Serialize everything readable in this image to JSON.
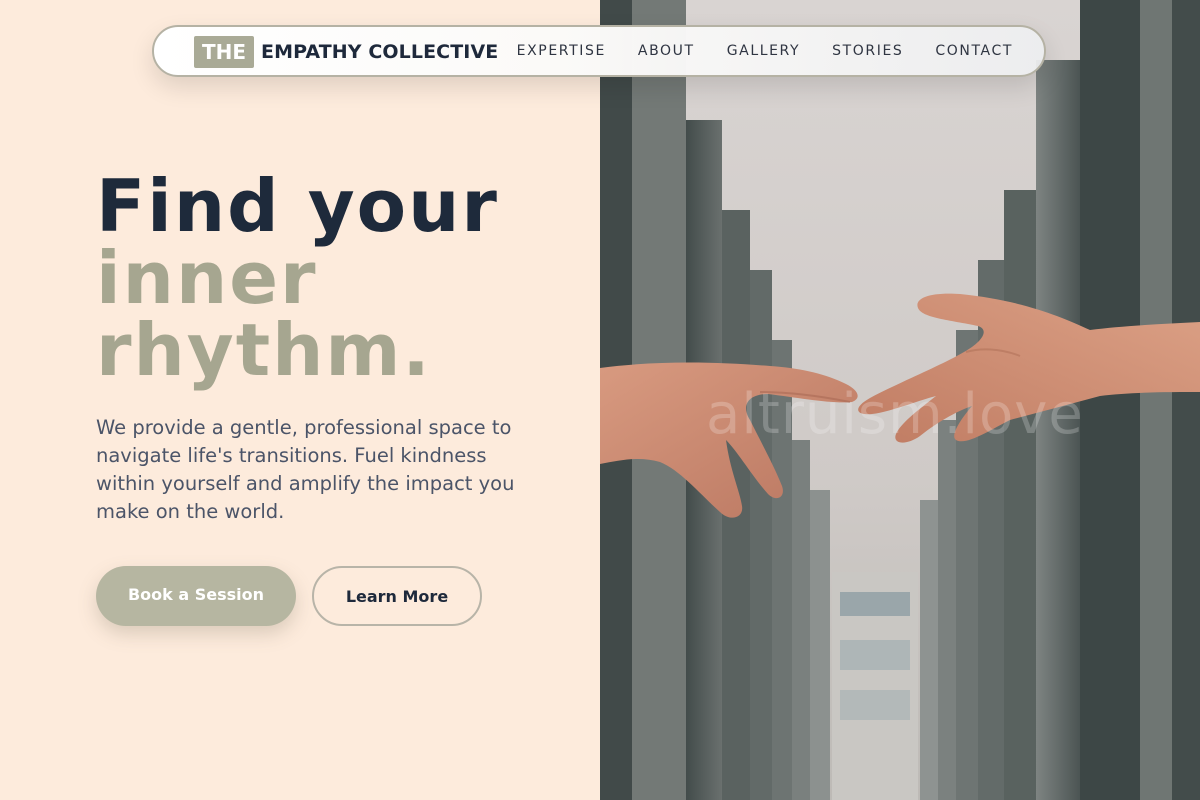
{
  "brand": {
    "badge": "THE",
    "name": "EMPATHY COLLECTIVE"
  },
  "nav": {
    "items": [
      {
        "label": "EXPERTISE"
      },
      {
        "label": "ABOUT"
      },
      {
        "label": "GALLERY"
      },
      {
        "label": "STORIES"
      },
      {
        "label": "CONTACT"
      }
    ]
  },
  "hero": {
    "headline_line1": "Find your",
    "headline_line2": "inner",
    "headline_line3": "rhythm.",
    "lead": "We provide a gentle, professional space to navigate life's transitions. Fuel kindness within yourself and amplify the impact you make on the world.",
    "primary_cta": "Book a Session",
    "secondary_cta": "Learn More",
    "image_watermark": "altruism.love"
  },
  "colors": {
    "page_background": "#fdebdc",
    "accent_sage": "#a6a690",
    "heading_navy": "#1e2a3b",
    "button_sage": "#b6b6a1"
  }
}
